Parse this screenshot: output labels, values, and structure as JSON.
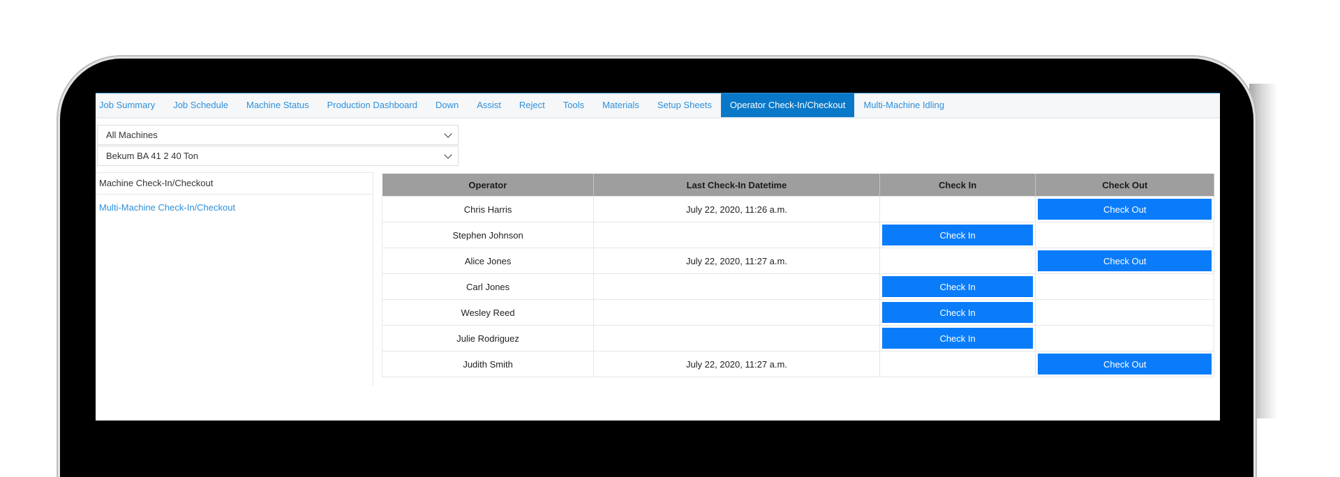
{
  "tabs": [
    {
      "label": "Job Summary",
      "active": false
    },
    {
      "label": "Job Schedule",
      "active": false
    },
    {
      "label": "Machine Status",
      "active": false
    },
    {
      "label": "Production Dashboard",
      "active": false
    },
    {
      "label": "Down",
      "active": false
    },
    {
      "label": "Assist",
      "active": false
    },
    {
      "label": "Reject",
      "active": false
    },
    {
      "label": "Tools",
      "active": false
    },
    {
      "label": "Materials",
      "active": false
    },
    {
      "label": "Setup Sheets",
      "active": false
    },
    {
      "label": "Operator Check-In/Checkout",
      "active": true
    },
    {
      "label": "Multi-Machine Idling",
      "active": false
    }
  ],
  "filters": {
    "machine_group": "All Machines",
    "machine": "Bekum BA 41 2 40 Ton"
  },
  "sidenav": {
    "current": "Machine Check-In/Checkout",
    "link": "Multi-Machine Check-In/Checkout"
  },
  "table": {
    "headers": [
      "Operator",
      "Last Check-In Datetime",
      "Check In",
      "Check Out"
    ],
    "rows": [
      {
        "operator": "Chris Harris",
        "last_check_in": "July 22, 2020, 11:26 a.m.",
        "action": "Check Out"
      },
      {
        "operator": "Stephen Johnson",
        "last_check_in": "",
        "action": "Check In"
      },
      {
        "operator": "Alice Jones",
        "last_check_in": "July 22, 2020, 11:27 a.m.",
        "action": "Check Out"
      },
      {
        "operator": "Carl Jones",
        "last_check_in": "",
        "action": "Check In"
      },
      {
        "operator": "Wesley Reed",
        "last_check_in": "",
        "action": "Check In"
      },
      {
        "operator": "Julie Rodriguez",
        "last_check_in": "",
        "action": "Check In"
      },
      {
        "operator": "Judith Smith",
        "last_check_in": "July 22, 2020, 11:27 a.m.",
        "action": "Check Out"
      }
    ]
  },
  "colors": {
    "link": "#2f8fd8",
    "active_tab": "#0a78c8",
    "button": "#0a7cfa",
    "header_bg": "#9e9e9e"
  }
}
